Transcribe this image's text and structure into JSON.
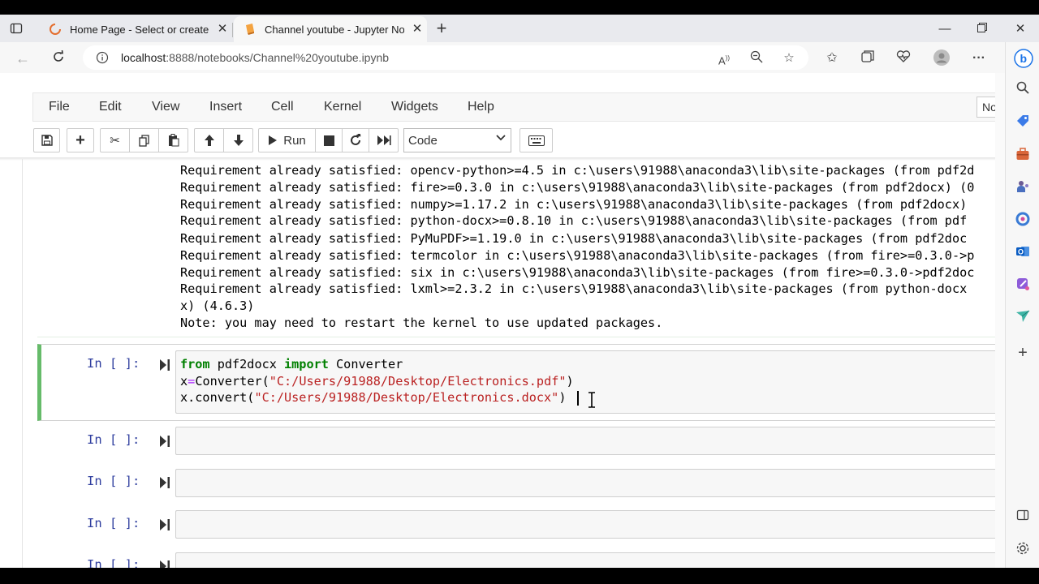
{
  "browser": {
    "tabs": [
      {
        "title": "Home Page - Select or create a notebook",
        "active": false
      },
      {
        "title": "Channel youtube - Jupyter Notebook",
        "active": true
      }
    ],
    "url_host": "localhost",
    "url_rest": ":8888/notebooks/Channel%20youtube.ipynb",
    "accent": "#0b57d0"
  },
  "jupyter": {
    "menu": [
      "File",
      "Edit",
      "View",
      "Insert",
      "Cell",
      "Kernel",
      "Widgets",
      "Help"
    ],
    "kernel_indicator": "No",
    "toolbar": {
      "run_label": "Run",
      "cell_type": "Code"
    },
    "output_lines": [
      "Requirement already satisfied: opencv-python>=4.5 in c:\\users\\91988\\anaconda3\\lib\\site-packages (from pdf2d",
      "Requirement already satisfied: fire>=0.3.0 in c:\\users\\91988\\anaconda3\\lib\\site-packages (from pdf2docx) (0",
      "Requirement already satisfied: numpy>=1.17.2 in c:\\users\\91988\\anaconda3\\lib\\site-packages (from pdf2docx)",
      "Requirement already satisfied: python-docx>=0.8.10 in c:\\users\\91988\\anaconda3\\lib\\site-packages (from pdf",
      "Requirement already satisfied: PyMuPDF>=1.19.0 in c:\\users\\91988\\anaconda3\\lib\\site-packages (from pdf2doc",
      "Requirement already satisfied: termcolor in c:\\users\\91988\\anaconda3\\lib\\site-packages (from fire>=0.3.0->p",
      "Requirement already satisfied: six in c:\\users\\91988\\anaconda3\\lib\\site-packages (from fire>=0.3.0->pdf2doc",
      "Requirement already satisfied: lxml>=2.3.2 in c:\\users\\91988\\anaconda3\\lib\\site-packages (from python-docx",
      "x) (4.6.3)",
      "Note: you may need to restart the kernel to use updated packages."
    ],
    "prompt_label": "In [ ]:",
    "code": {
      "line1": {
        "kw_from": "from",
        "module": " pdf2docx ",
        "kw_import": "import",
        "name": " Converter"
      },
      "line2": {
        "var": "x",
        "eq": "=",
        "call": "Converter(",
        "arg": "\"C:/Users/91988/Desktop/Electronics.pdf\"",
        "close": ")"
      },
      "line3": {
        "call": "x.convert(",
        "arg": "\"C:/Users/91988/Desktop/Electronics.docx\"",
        "close": ")"
      }
    }
  }
}
